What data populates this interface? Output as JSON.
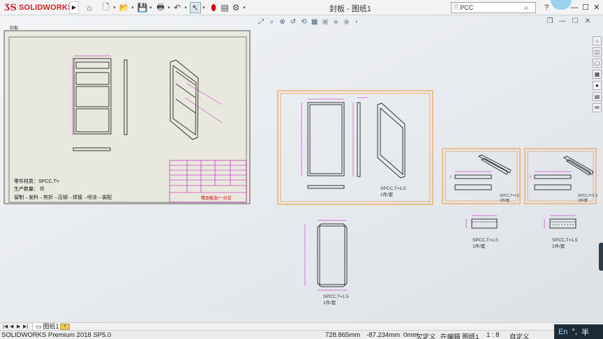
{
  "app": {
    "brand": "SOLIDWORKS",
    "document_title": "封板 - 图纸1",
    "search_placeholder": "PCC"
  },
  "toolbar": {
    "icons": [
      "new-file-icon",
      "open-file-icon",
      "save-icon",
      "print-icon",
      "undo-icon",
      "select-icon",
      "traffic-light-icon",
      "file-properties-icon",
      "options-gear-icon"
    ]
  },
  "sheet": {
    "view_label": "封板",
    "notes": [
      "零件材质：SPCC,T="
    ],
    "note_qty": "生产数量：   件",
    "note_flow": "留制→发料→剪折→压铆→焊接→喷涂→装配",
    "title_block_mark": "精品板金/一分又"
  },
  "views": {
    "main_label": "SPCC,T=1.5",
    "main_qty": "1件/套",
    "flat_label": "SPCC,T=1.5",
    "flat_qty": "1件/套",
    "part2_label": "SPCC,T=1.5",
    "part2_qty": "1件/套",
    "part3_label": "SPCC,T=1.5",
    "part3_qty": "1件/套",
    "part2_note": "SPCC,T=1.5",
    "part2_note_qty": "1件/套",
    "part3_note": "SPCC,T=1.5",
    "part3_note_qty": "1件/套"
  },
  "sheet_tabs": {
    "active": "图纸1"
  },
  "status": {
    "product": "SOLIDWORKS Premium 2018 SP5.0",
    "x": "728.865mm",
    "y": "-87.234mm",
    "z": "0mm",
    "state": "欠定义",
    "mode": "在编辑 图纸1",
    "scale": "1 : 8",
    "units": "自定义"
  },
  "ime": {
    "lang": "En",
    "half": "半"
  },
  "colors": {
    "brand_red": "#d4202c",
    "view_frame": "#f0a050",
    "geometry_magenta": "#c000c0",
    "model_line": "#333333",
    "sheet_bg": "#e8e8de"
  }
}
